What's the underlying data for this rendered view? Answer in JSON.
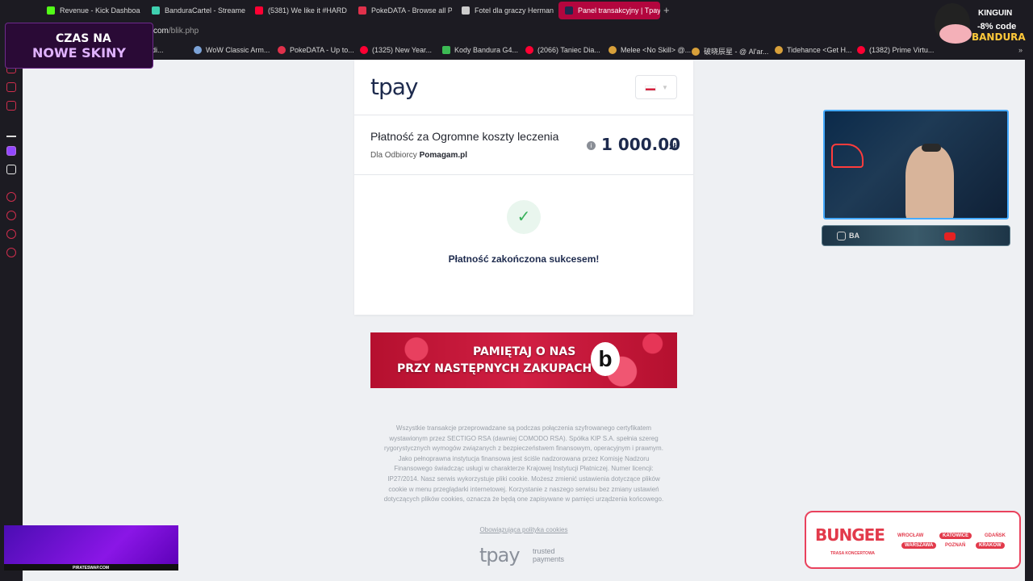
{
  "browser": {
    "tabs": [
      {
        "label": "Revenue - Kick Dashboard",
        "color": "#53fc18"
      },
      {
        "label": "BanduraCartel - Streamer",
        "color": "#3fd0b0"
      },
      {
        "label": "(5381) We like it #HARD T",
        "color": "#ff0033"
      },
      {
        "label": "PokeDATA - Browse all Po",
        "color": "#e0314b"
      },
      {
        "label": "Fotel dla graczy Herman",
        "color": "#cccccc"
      },
      {
        "label": "Panel transakcyjny | Tpay",
        "color": "#1d2a4d"
      }
    ],
    "url_prefix": "com",
    "url_path": "/blik.php",
    "bookmarks": [
      {
        "label": "Paladi...",
        "color": "#888888"
      },
      {
        "label": "WoW Classic Arm...",
        "color": "#7ca3d8"
      },
      {
        "label": "PokeDATA - Up to...",
        "color": "#e0314b"
      },
      {
        "label": "(1325) New Year...",
        "color": "#ff0033"
      },
      {
        "label": "Kody Bandura G4...",
        "color": "#3cba54"
      },
      {
        "label": "(2066) Taniec Dia...",
        "color": "#ff0033"
      },
      {
        "label": "Melee <No Skill> @...",
        "color": "#d8a03a"
      },
      {
        "label": "破晓辰星 - @ Al'ar...",
        "color": "#d8a03a"
      },
      {
        "label": "Tidehance <Get H...",
        "color": "#d8a03a"
      },
      {
        "label": "(1382) Prime Virtu...",
        "color": "#ff0033"
      }
    ]
  },
  "tpay": {
    "logo": "tpay",
    "payment_title": "Płatność za Ogromne koszty leczenia",
    "recipient_prefix": "Dla Odbiorcy",
    "recipient": "Pomagam.pl",
    "amount": "1 000.00",
    "currency": "zł",
    "success_message": "Płatność zakończona sukcesem!",
    "banner_line1": "PAMIĘTAJ O NAS",
    "banner_line2": "PRZY NASTĘPNYCH ZAKUPACH",
    "banner_logo": "b",
    "footer_text": "Wszystkie transakcje przeprowadzane są podczas połączenia szyfrowanego certyfikatem wystawionym przez SECTIGO RSA (dawniej COMODO RSA). Spółka KIP S.A. spełnia szereg rygorystycznych wymogów związanych z bezpieczeństwem finansowym, operacyjnym i prawnym. Jako pełnoprawna instytucja finansowa jest ściśle nadzorowana przez Komisję Nadzoru Finansowego świadcząc usługi w charakterze Krajowej Instytucji Płatniczej. Numer licencji: IP27/2014. Nasz serwis wykorzystuje pliki cookie. Możesz zmienić ustawienia dotyczące plików cookie w menu przeglądarki internetowej. Korzystanie z naszego serwisu bez zmiany ustawień dotyczących plików cookies, oznacza że będą one zapisywane w pamięci urządzenia końcowego.",
    "footer_link": "Obowiązująca polityka cookies",
    "footer_logo": "tpay",
    "footer_trusted": "trusted",
    "footer_payments": "payments"
  },
  "overlays": {
    "czas_line1": "CZAS NA",
    "czas_line2": "NOWE SKINY",
    "kinguin": "KINGUIN",
    "kinguin_code": "-8% code",
    "kinguin_brand": "BANDURA",
    "cam_handle": "BA",
    "purple_text": "PIRATESWAP.COM",
    "bungee": "BUNGEE",
    "bungee_sub": "TRASA KONCERTOWA",
    "cities": [
      "WROCŁAW",
      "KATOWICE",
      "GDAŃSK",
      "WARSZAWA",
      "POZNAŃ",
      "KRAKÓW"
    ]
  }
}
